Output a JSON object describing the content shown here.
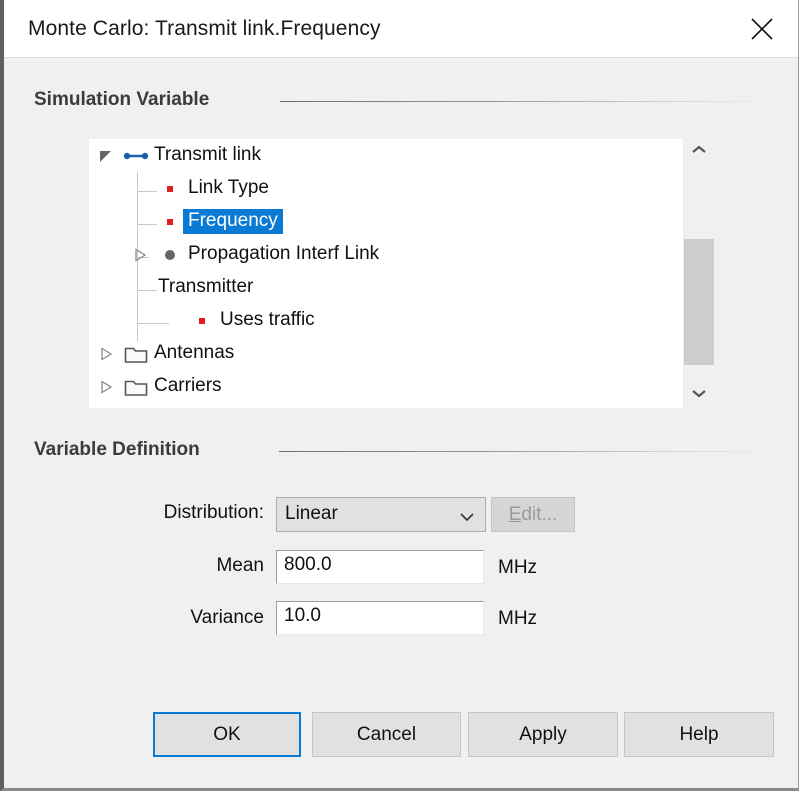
{
  "window": {
    "title": "Monte Carlo: Transmit link.Frequency",
    "close_icon": "close-icon",
    "accent_color": "#0a7bd4"
  },
  "groups": {
    "simulation_variable": "Simulation Variable",
    "variable_definition": "Variable Definition"
  },
  "tree": {
    "items": [
      {
        "label": "Transmit link",
        "icon": "link-icon",
        "twisty": "expanded",
        "depth": 0,
        "selected": false
      },
      {
        "label": "Link Type",
        "icon": "red-square-icon",
        "twisty": "none",
        "depth": 1,
        "selected": false
      },
      {
        "label": "Frequency",
        "icon": "red-square-icon",
        "twisty": "none",
        "depth": 1,
        "selected": true
      },
      {
        "label": "Propagation Interf Link",
        "icon": "gray-dot-icon",
        "twisty": "collapsed",
        "depth": 1,
        "selected": false
      },
      {
        "label": "Transmitter",
        "icon": "none",
        "twisty": "none",
        "depth": 1,
        "selected": false
      },
      {
        "label": "Uses traffic",
        "icon": "red-square-icon",
        "twisty": "none",
        "depth": 2,
        "selected": false
      },
      {
        "label": "Antennas",
        "icon": "folder-icon",
        "twisty": "collapsed",
        "depth": 0,
        "selected": false
      },
      {
        "label": "Carriers",
        "icon": "folder-icon",
        "twisty": "collapsed",
        "depth": 0,
        "selected": false
      }
    ],
    "scrollbar": {
      "up_icon": "chevron-up-icon",
      "down_icon": "chevron-down-icon"
    }
  },
  "form": {
    "distribution_label": "Distribution:",
    "distribution_value": "Linear",
    "distribution_arrow_icon": "chevron-down-icon",
    "edit_button_prefix": "",
    "edit_button_mnemonic": "E",
    "edit_button_suffix": "dit...",
    "mean_label": "Mean",
    "mean_value": "800.0",
    "mean_unit": "MHz",
    "variance_label": "Variance",
    "variance_value": "10.0",
    "variance_unit": "MHz"
  },
  "buttons": {
    "ok": "OK",
    "cancel": "Cancel",
    "apply": "Apply",
    "help": "Help"
  }
}
